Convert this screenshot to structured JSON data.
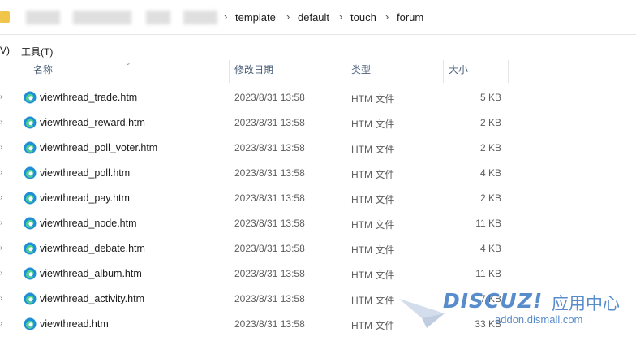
{
  "breadcrumb": {
    "items": [
      "template",
      "default",
      "touch",
      "forum"
    ],
    "separator": "›"
  },
  "menu": {
    "left_fragment": "V)",
    "tools": "工具(T)"
  },
  "columns": {
    "name": "名称",
    "modified": "修改日期",
    "type": "类型",
    "size": "大小"
  },
  "files": [
    {
      "name": "viewthread_trade.htm",
      "modified": "2023/8/31 13:58",
      "type": "HTM 文件",
      "size": "5 KB"
    },
    {
      "name": "viewthread_reward.htm",
      "modified": "2023/8/31 13:58",
      "type": "HTM 文件",
      "size": "2 KB"
    },
    {
      "name": "viewthread_poll_voter.htm",
      "modified": "2023/8/31 13:58",
      "type": "HTM 文件",
      "size": "2 KB"
    },
    {
      "name": "viewthread_poll.htm",
      "modified": "2023/8/31 13:58",
      "type": "HTM 文件",
      "size": "4 KB"
    },
    {
      "name": "viewthread_pay.htm",
      "modified": "2023/8/31 13:58",
      "type": "HTM 文件",
      "size": "2 KB"
    },
    {
      "name": "viewthread_node.htm",
      "modified": "2023/8/31 13:58",
      "type": "HTM 文件",
      "size": "11 KB"
    },
    {
      "name": "viewthread_debate.htm",
      "modified": "2023/8/31 13:58",
      "type": "HTM 文件",
      "size": "4 KB"
    },
    {
      "name": "viewthread_album.htm",
      "modified": "2023/8/31 13:58",
      "type": "HTM 文件",
      "size": "11 KB"
    },
    {
      "name": "viewthread_activity.htm",
      "modified": "2023/8/31 13:58",
      "type": "HTM 文件",
      "size": "7 KB"
    },
    {
      "name": "viewthread.htm",
      "modified": "2023/8/31 13:58",
      "type": "HTM 文件",
      "size": "33 KB"
    }
  ],
  "file_icon": "edge-browser-icon",
  "watermark": {
    "logo": "DISCUZ!",
    "cn": "应用中心",
    "url": "addon.dismall.com"
  },
  "colors": {
    "header_text": "#4c607a",
    "folder": "#f0c54a",
    "watermark": "#3b78c3"
  }
}
